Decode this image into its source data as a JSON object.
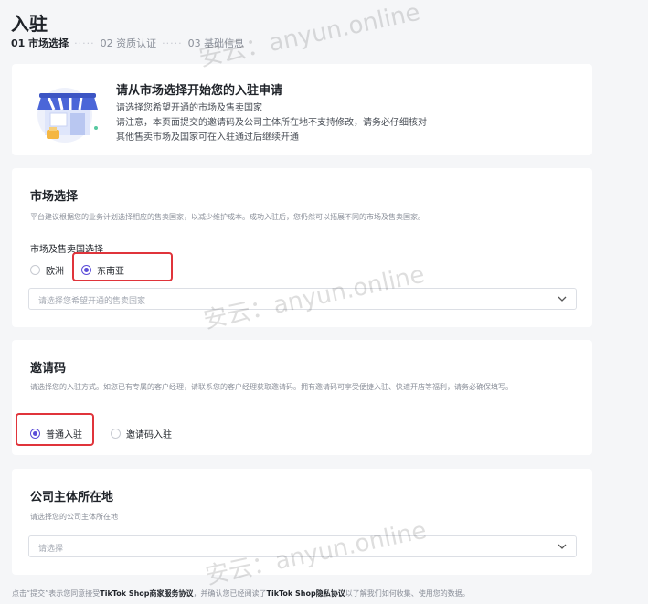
{
  "page": {
    "title": "入驻"
  },
  "steps": [
    {
      "label": "01 市场选择",
      "active": true
    },
    {
      "label": "02 资质认证",
      "active": false
    },
    {
      "label": "03 基础信息",
      "active": false
    }
  ],
  "intro": {
    "title": "请从市场选择开始您的入驻申请",
    "lines": [
      "请选择您希望开通的市场及售卖国家",
      "请注意，本页面提交的邀请码及公司主体所在地不支持修改，请务必仔细核对",
      "其他售卖市场及国家可在入驻通过后继续开通"
    ]
  },
  "market": {
    "title": "市场选择",
    "desc": "平台建议根据您的业务计划选择相应的售卖国家，以减少维护成本。成功入驻后，您仍然可以拓展不同的市场及售卖国家。",
    "field_label": "市场及售卖国选择",
    "options": [
      "欧洲",
      "东南亚"
    ],
    "selected": "东南亚",
    "country_placeholder": "请选择您希望开通的售卖国家"
  },
  "invite": {
    "title": "邀请码",
    "desc": "请选择您的入驻方式。如您已有专属的客户经理，请联系您的客户经理获取邀请码。拥有邀请码可享受便捷入驻、快速开店等福利，请务必确保填写。",
    "options": [
      "普通入驻",
      "邀请码入驻"
    ],
    "selected": "普通入驻"
  },
  "company": {
    "title": "公司主体所在地",
    "desc": "请选择您的公司主体所在地",
    "placeholder": "请选择"
  },
  "footer": {
    "prefix": "点击“提交”表示您同意接受",
    "link1": "TikTok Shop商家服务协议",
    "middle": "，并确认您已经阅读了",
    "link2": "TikTok Shop隐私协议",
    "suffix": "以了解我们如何收集、使用您的数据。"
  },
  "watermark": "安云：anyun.online",
  "colors": {
    "accent": "#5b4dd8",
    "highlight": "#e0343b"
  }
}
